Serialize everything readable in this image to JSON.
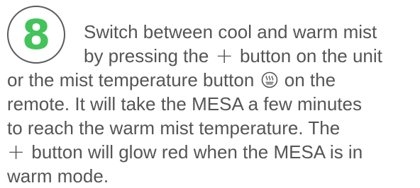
{
  "step": {
    "number": "8",
    "number_color": "#43c35a",
    "text_color": "#555555",
    "line1": "Switch between cool and warm mist",
    "line2_before": "by pressing the",
    "plus_symbol": "+",
    "line2_after": "button on the unit",
    "line3_before": "or the mist temperature button",
    "line3_after": "on the",
    "line4": "remote. It will take the MESA a few minutes",
    "line5": "to reach the warm mist temperature. The",
    "line6_after": "button will glow red when the MESA is in",
    "line7": "warm mode.",
    "icons": [
      "plus-icon",
      "warm-mist-icon"
    ]
  }
}
